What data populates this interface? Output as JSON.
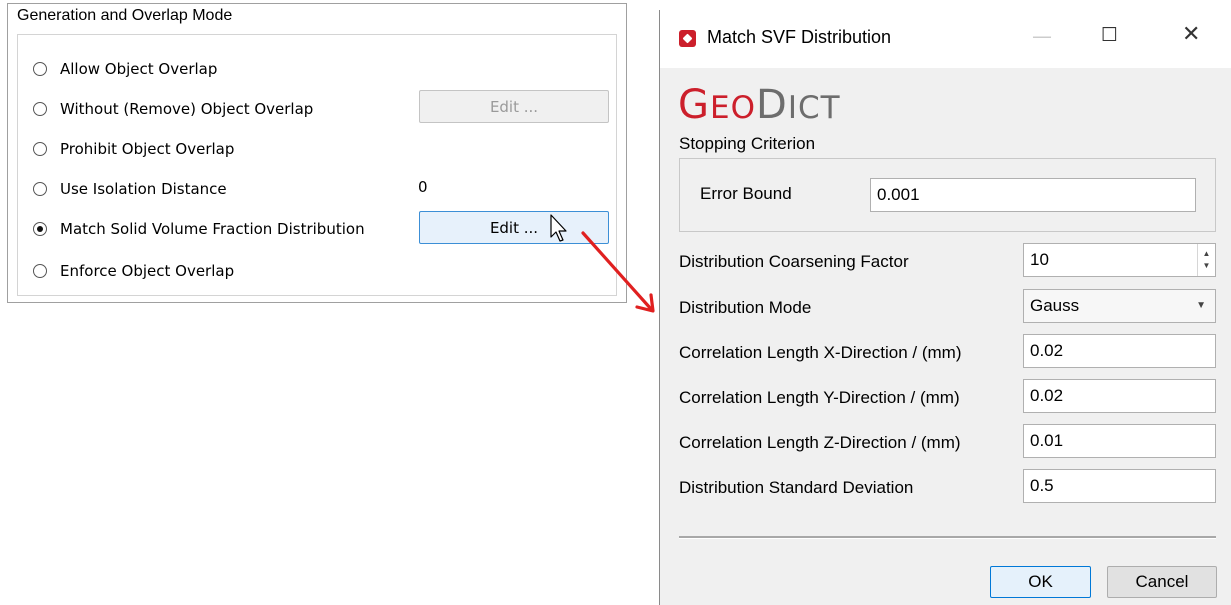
{
  "overlap_panel": {
    "title": "Generation and Overlap Mode",
    "options": [
      {
        "label": "Allow Object Overlap",
        "checked": false
      },
      {
        "label": "Without (Remove) Object Overlap",
        "checked": false
      },
      {
        "label": "Prohibit Object Overlap",
        "checked": false
      },
      {
        "label": "Use Isolation Distance",
        "checked": false
      },
      {
        "label": "Match Solid Volume Fraction Distribution",
        "checked": true
      },
      {
        "label": "Enforce Object Overlap",
        "checked": false
      }
    ],
    "edit_remove_label": "Edit ...",
    "edit_match_label": "Edit ...",
    "isolation_distance_value": "0"
  },
  "dialog": {
    "title": "Match SVF Distribution",
    "logo_part1_big": "G",
    "logo_part1_small": "EO",
    "logo_part2_big": "D",
    "logo_part2_small": "ICT",
    "stopping_criterion_label": "Stopping Criterion",
    "error_bound_label": "Error Bound",
    "error_bound_value": "0.001",
    "coarsening_label": "Distribution Coarsening Factor",
    "coarsening_value": "10",
    "mode_label": "Distribution Mode",
    "mode_value": "Gauss",
    "corr_x_label": "Correlation Length X-Direction / (mm)",
    "corr_x_value": "0.02",
    "corr_y_label": "Correlation Length Y-Direction / (mm)",
    "corr_y_value": "0.02",
    "corr_z_label": "Correlation Length Z-Direction / (mm)",
    "corr_z_value": "0.01",
    "std_dev_label": "Distribution Standard Deviation",
    "std_dev_value": "0.5",
    "ok_label": "OK",
    "cancel_label": "Cancel",
    "minimize_glyph": "—",
    "maximize_glyph": "☐",
    "close_glyph": "✕"
  },
  "colors": {
    "brand_red": "#cc1f2b",
    "logo_gray": "#6d6d6d",
    "arrow_red": "#e02020",
    "focus_blue": "#0078d7"
  }
}
